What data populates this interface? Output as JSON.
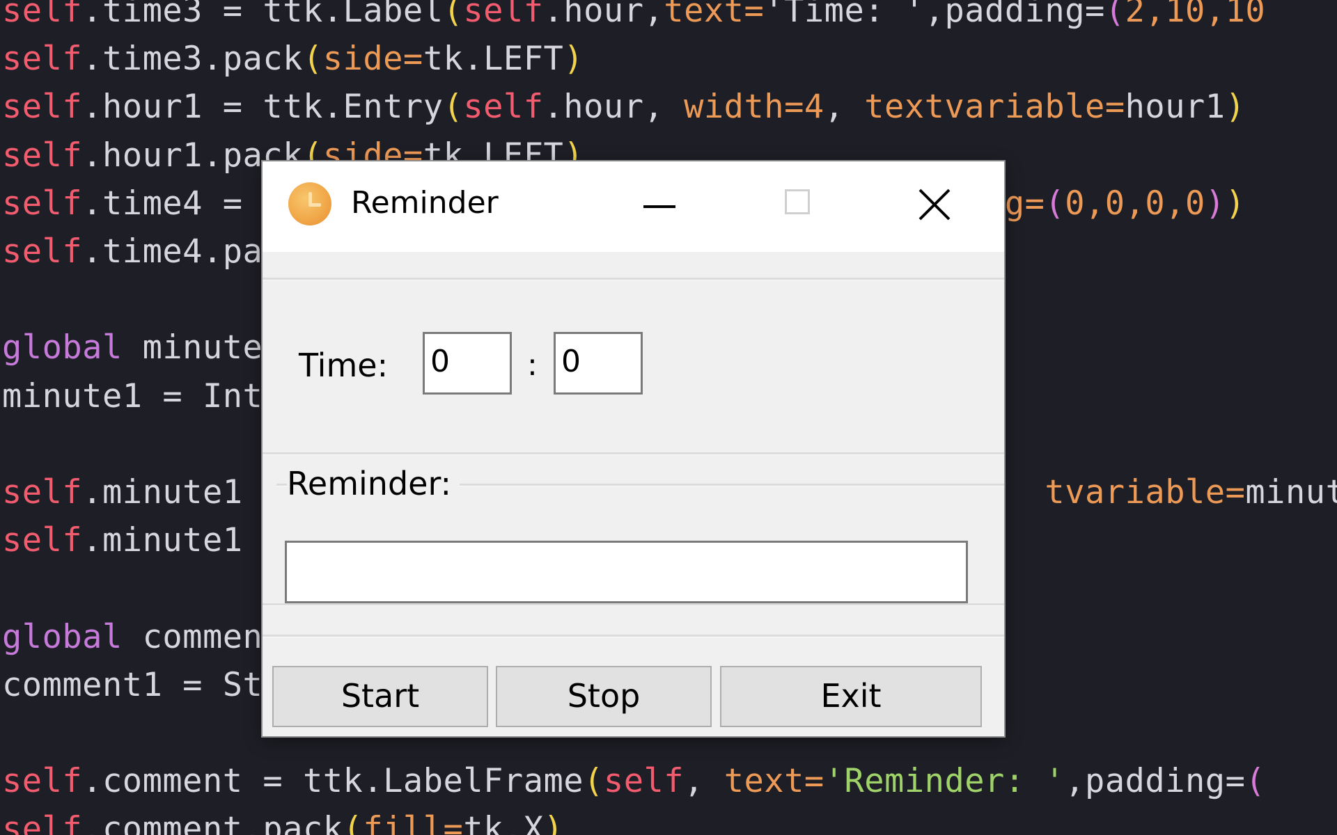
{
  "editor": {
    "lines": [
      [
        [
          "self",
          "tok-self"
        ],
        [
          ".time3 = ttk.Label",
          ""
        ],
        [
          "(",
          "tok-paren"
        ],
        [
          "self",
          "tok-self"
        ],
        [
          ".hour,",
          ""
        ],
        [
          "text=",
          "tok-param"
        ],
        [
          "'Time: '",
          ""
        ],
        [
          ",padding=",
          ""
        ],
        [
          "(",
          "tok-paren2"
        ],
        [
          "2,10,10",
          "tok-num"
        ]
      ],
      [
        [
          "self",
          "tok-self"
        ],
        [
          ".time3.pack",
          ""
        ],
        [
          "(",
          "tok-paren"
        ],
        [
          "side=",
          "tok-param"
        ],
        [
          "tk.LEFT",
          ""
        ],
        [
          ")",
          "tok-paren"
        ]
      ],
      [
        [
          "self",
          "tok-self"
        ],
        [
          ".hour1 = ttk.Entry",
          ""
        ],
        [
          "(",
          "tok-paren"
        ],
        [
          "self",
          "tok-self"
        ],
        [
          ".hour, ",
          ""
        ],
        [
          "width=",
          "tok-param"
        ],
        [
          "4",
          "tok-num"
        ],
        [
          ", ",
          ""
        ],
        [
          "textvariable=",
          "tok-param"
        ],
        [
          "hour1",
          ""
        ],
        [
          ")",
          "tok-paren"
        ]
      ],
      [
        [
          "self",
          "tok-self"
        ],
        [
          ".hour1.pack",
          ""
        ],
        [
          "(",
          "tok-paren"
        ],
        [
          "side=",
          "tok-param"
        ],
        [
          "tk.LEFT",
          ""
        ],
        [
          ")",
          "tok-paren"
        ]
      ],
      [
        [
          "self",
          "tok-self"
        ],
        [
          ".time4 = ",
          ""
        ],
        [
          "                                  ",
          ""
        ],
        [
          "ding=",
          "tok-param"
        ],
        [
          "(",
          "tok-paren2"
        ],
        [
          "0,0,0,0",
          "tok-num"
        ],
        [
          ")",
          "tok-paren2"
        ],
        [
          ")",
          "tok-paren"
        ]
      ],
      [
        [
          "self",
          "tok-self"
        ],
        [
          ".time4.pa",
          ""
        ]
      ],
      [
        [
          "",
          ""
        ]
      ],
      [
        [
          "global",
          "tok-kw"
        ],
        [
          " minute",
          ""
        ]
      ],
      [
        [
          "minute1 = Int",
          ""
        ]
      ],
      [
        [
          "",
          ""
        ]
      ],
      [
        [
          "self",
          "tok-self"
        ],
        [
          ".minute1",
          ""
        ],
        [
          "                                        ",
          ""
        ],
        [
          "tvariable=",
          "tok-param"
        ],
        [
          "minute",
          ""
        ]
      ],
      [
        [
          "self",
          "tok-self"
        ],
        [
          ".minute1",
          ""
        ]
      ],
      [
        [
          "",
          ""
        ]
      ],
      [
        [
          "global",
          "tok-kw"
        ],
        [
          " commen",
          ""
        ]
      ],
      [
        [
          "comment1 = St",
          ""
        ]
      ],
      [
        [
          "",
          ""
        ]
      ],
      [
        [
          "self",
          "tok-self"
        ],
        [
          ".comment = ttk.LabelFrame",
          ""
        ],
        [
          "(",
          "tok-paren"
        ],
        [
          "self",
          "tok-self"
        ],
        [
          ", ",
          ""
        ],
        [
          "text=",
          "tok-param"
        ],
        [
          "'Reminder: '",
          "tok-str"
        ],
        [
          ",padding=",
          ""
        ],
        [
          "(",
          "tok-paren2"
        ]
      ],
      [
        [
          "self",
          "tok-self"
        ],
        [
          ".comment.pack",
          ""
        ],
        [
          "(",
          "tok-paren"
        ],
        [
          "fill=",
          "tok-param"
        ],
        [
          "tk.X",
          ""
        ],
        [
          ")",
          "tok-paren"
        ]
      ]
    ]
  },
  "dialog": {
    "title": "Reminder",
    "app_icon": "clock-icon",
    "time_label": "Time:",
    "hour_value": "0",
    "colon": ":",
    "minute_value": "0",
    "reminder_label": "Reminder:",
    "reminder_value": "",
    "buttons": {
      "start": "Start",
      "stop": "Stop",
      "exit": "Exit"
    }
  }
}
